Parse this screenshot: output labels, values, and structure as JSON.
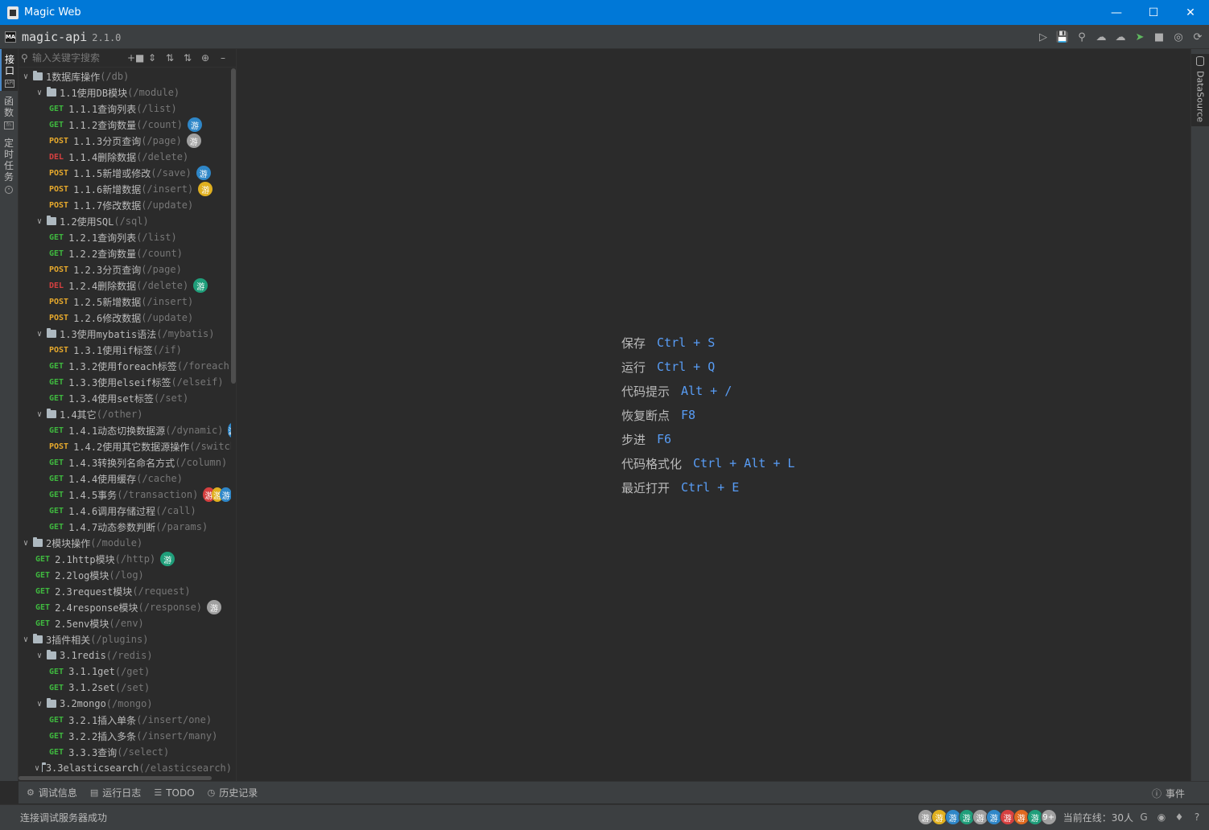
{
  "window": {
    "title": "Magic Web"
  },
  "header": {
    "app_name": "magic-api",
    "version": "2.1.0",
    "logo": "MA",
    "tools": [
      "run-icon",
      "save-icon",
      "search-icon",
      "upload-icon",
      "download-icon",
      "push-icon",
      "skin-icon",
      "language-icon",
      "refresh-icon"
    ]
  },
  "left_tabs": [
    {
      "label": "接口",
      "icon": "api-icon",
      "active": true
    },
    {
      "label": "函数",
      "icon": "function-icon",
      "active": false
    },
    {
      "label": "定时任务",
      "icon": "clock-icon",
      "active": false
    }
  ],
  "sidebar": {
    "search_placeholder": "输入关键字搜索"
  },
  "tree": [
    {
      "type": "folder",
      "level": 0,
      "name": "1数据库操作",
      "path": "(/db)"
    },
    {
      "type": "folder",
      "level": 1,
      "name": "1.1使用DB模块",
      "path": "(/module)"
    },
    {
      "type": "api",
      "level": 2,
      "method": "GET",
      "name": "1.1.1查询列表",
      "path": "(/list)"
    },
    {
      "type": "api",
      "level": 2,
      "method": "GET",
      "name": "1.1.2查询数量",
      "path": "(/count)",
      "badges": [
        "#2f87c8"
      ]
    },
    {
      "type": "api",
      "level": 2,
      "method": "POST",
      "name": "1.1.3分页查询",
      "path": "(/page)",
      "badges": [
        "#a0a0a0"
      ]
    },
    {
      "type": "api",
      "level": 2,
      "method": "DEL",
      "name": "1.1.4删除数据",
      "path": "(/delete)"
    },
    {
      "type": "api",
      "level": 2,
      "method": "POST",
      "name": "1.1.5新增或修改",
      "path": "(/save)",
      "badges": [
        "#2f87c8"
      ]
    },
    {
      "type": "api",
      "level": 2,
      "method": "POST",
      "name": "1.1.6新增数据",
      "path": "(/insert)",
      "badges": [
        "#e0b020"
      ]
    },
    {
      "type": "api",
      "level": 2,
      "method": "POST",
      "name": "1.1.7修改数据",
      "path": "(/update)"
    },
    {
      "type": "folder",
      "level": 1,
      "name": "1.2使用SQL",
      "path": "(/sql)"
    },
    {
      "type": "api",
      "level": 2,
      "method": "GET",
      "name": "1.2.1查询列表",
      "path": "(/list)"
    },
    {
      "type": "api",
      "level": 2,
      "method": "GET",
      "name": "1.2.2查询数量",
      "path": "(/count)"
    },
    {
      "type": "api",
      "level": 2,
      "method": "POST",
      "name": "1.2.3分页查询",
      "path": "(/page)"
    },
    {
      "type": "api",
      "level": 2,
      "method": "DEL",
      "name": "1.2.4删除数据",
      "path": "(/delete)",
      "badges": [
        "#1f9e7a"
      ]
    },
    {
      "type": "api",
      "level": 2,
      "method": "POST",
      "name": "1.2.5新增数据",
      "path": "(/insert)"
    },
    {
      "type": "api",
      "level": 2,
      "method": "POST",
      "name": "1.2.6修改数据",
      "path": "(/update)"
    },
    {
      "type": "folder",
      "level": 1,
      "name": "1.3使用mybatis语法",
      "path": "(/mybatis)"
    },
    {
      "type": "api",
      "level": 2,
      "method": "POST",
      "name": "1.3.1使用if标签",
      "path": "(/if)"
    },
    {
      "type": "api",
      "level": 2,
      "method": "GET",
      "name": "1.3.2使用foreach标签",
      "path": "(/foreach)"
    },
    {
      "type": "api",
      "level": 2,
      "method": "GET",
      "name": "1.3.3使用elseif标签",
      "path": "(/elseif)"
    },
    {
      "type": "api",
      "level": 2,
      "method": "GET",
      "name": "1.3.4使用set标签",
      "path": "(/set)"
    },
    {
      "type": "folder",
      "level": 1,
      "name": "1.4其它",
      "path": "(/other)"
    },
    {
      "type": "api",
      "level": 2,
      "method": "GET",
      "name": "1.4.1动态切换数据源",
      "path": "(/dynamic)",
      "badges": [
        "#2f87c8"
      ]
    },
    {
      "type": "api",
      "level": 2,
      "method": "POST",
      "name": "1.4.2使用其它数据源操作",
      "path": "(/switch)"
    },
    {
      "type": "api",
      "level": 2,
      "method": "GET",
      "name": "1.4.3转换列名命名方式",
      "path": "(/column)",
      "badges": [
        "#2f87c8"
      ]
    },
    {
      "type": "api",
      "level": 2,
      "method": "GET",
      "name": "1.4.4使用缓存",
      "path": "(/cache)"
    },
    {
      "type": "api",
      "level": 2,
      "method": "GET",
      "name": "1.4.5事务",
      "path": "(/transaction)",
      "badges": [
        "#d64040",
        "#e0b020",
        "#2f87c8"
      ]
    },
    {
      "type": "api",
      "level": 2,
      "method": "GET",
      "name": "1.4.6调用存储过程",
      "path": "(/call)"
    },
    {
      "type": "api",
      "level": 2,
      "method": "GET",
      "name": "1.4.7动态参数判断",
      "path": "(/params)"
    },
    {
      "type": "folder",
      "level": 0,
      "name": "2模块操作",
      "path": "(/module)"
    },
    {
      "type": "api",
      "level": 1,
      "method": "GET",
      "name": "2.1http模块",
      "path": "(/http)",
      "badges": [
        "#1f9e7a"
      ]
    },
    {
      "type": "api",
      "level": 1,
      "method": "GET",
      "name": "2.2log模块",
      "path": "(/log)"
    },
    {
      "type": "api",
      "level": 1,
      "method": "GET",
      "name": "2.3request模块",
      "path": "(/request)"
    },
    {
      "type": "api",
      "level": 1,
      "method": "GET",
      "name": "2.4response模块",
      "path": "(/response)",
      "badges": [
        "#a0a0a0"
      ]
    },
    {
      "type": "api",
      "level": 1,
      "method": "GET",
      "name": "2.5env模块",
      "path": "(/env)"
    },
    {
      "type": "folder",
      "level": 0,
      "name": "3插件相关",
      "path": "(/plugins)"
    },
    {
      "type": "folder",
      "level": 1,
      "name": "3.1redis",
      "path": "(/redis)"
    },
    {
      "type": "api",
      "level": 2,
      "method": "GET",
      "name": "3.1.1get",
      "path": "(/get)"
    },
    {
      "type": "api",
      "level": 2,
      "method": "GET",
      "name": "3.1.2set",
      "path": "(/set)"
    },
    {
      "type": "folder",
      "level": 1,
      "name": "3.2mongo",
      "path": "(/mongo)"
    },
    {
      "type": "api",
      "level": 2,
      "method": "GET",
      "name": "3.2.1插入单条",
      "path": "(/insert/one)"
    },
    {
      "type": "api",
      "level": 2,
      "method": "GET",
      "name": "3.2.2插入多条",
      "path": "(/insert/many)"
    },
    {
      "type": "api",
      "level": 2,
      "method": "GET",
      "name": "3.3.3查询",
      "path": "(/select)"
    },
    {
      "type": "folder",
      "level": 1,
      "name": "3.3elasticsearch",
      "path": "(/elasticsearch)"
    }
  ],
  "badge_text": "游",
  "shortcuts": [
    {
      "label": "保存",
      "key": "Ctrl + S"
    },
    {
      "label": "运行",
      "key": "Ctrl + Q"
    },
    {
      "label": "代码提示",
      "key": "Alt + /"
    },
    {
      "label": "恢复断点",
      "key": "F8"
    },
    {
      "label": "步进",
      "key": "F6"
    },
    {
      "label": "代码格式化",
      "key": "Ctrl + Alt + L"
    },
    {
      "label": "最近打开",
      "key": "Ctrl + E"
    }
  ],
  "right_tab": {
    "label": "DataSource"
  },
  "bottom_bar": {
    "items": [
      {
        "label": "调试信息",
        "icon": "bug-icon"
      },
      {
        "label": "运行日志",
        "icon": "log-icon"
      },
      {
        "label": "TODO",
        "icon": "list-icon"
      },
      {
        "label": "历史记录",
        "icon": "history-icon"
      }
    ],
    "events_label": "事件"
  },
  "status_bar": {
    "message": "连接调试服务器成功",
    "avatars": [
      {
        "text": "游",
        "color": "#a0a0a0"
      },
      {
        "text": "游",
        "color": "#e0b020"
      },
      {
        "text": "游",
        "color": "#2f87c8"
      },
      {
        "text": "游",
        "color": "#1f9e7a"
      },
      {
        "text": "游",
        "color": "#a0a0a0"
      },
      {
        "text": "游",
        "color": "#2f87c8"
      },
      {
        "text": "游",
        "color": "#d64040"
      },
      {
        "text": "游",
        "color": "#e06a20"
      },
      {
        "text": "游",
        "color": "#1f9e7a"
      },
      {
        "text": "9+",
        "color": "#a0a0a0"
      }
    ],
    "online_label": "当前在线：30人"
  },
  "colors": {
    "accent": "#589df6",
    "get": "#3fb83f",
    "post": "#e5a82c",
    "del": "#d64040",
    "titlebar": "#0078d7"
  }
}
